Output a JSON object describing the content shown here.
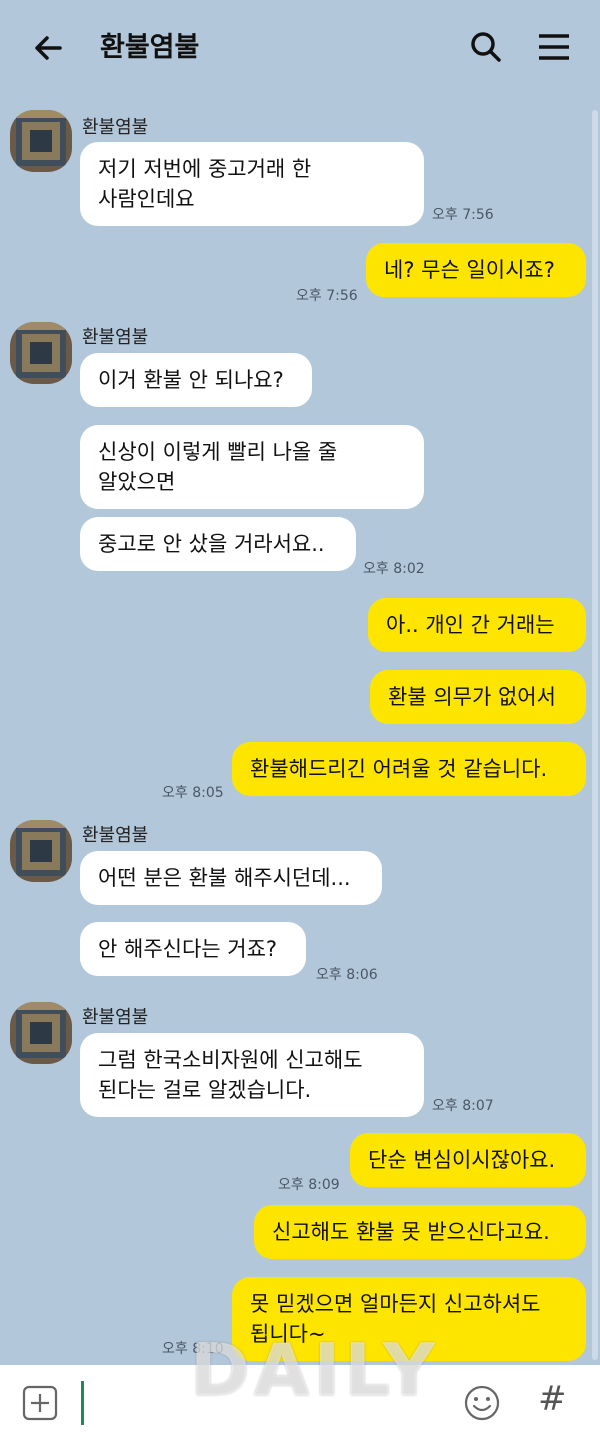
{
  "header": {
    "title": "환불염불",
    "back_icon": "arrow-left-icon",
    "search_icon": "search-icon",
    "menu_icon": "hamburger-menu-icon"
  },
  "colors": {
    "background": "#b2c7da",
    "incoming_bubble": "#ffffff",
    "outgoing_bubble": "#fee500"
  },
  "messages": [
    {
      "sender": "환불염불",
      "text_lines": [
        "저기 저번에 중고거래 한",
        "사람인데요"
      ],
      "time": "오후 7:56"
    },
    {
      "direction": "out",
      "text": "네? 무슨 일이시죠?",
      "time": "오후 7:56"
    },
    {
      "sender": "환불염불",
      "text": "이거 환불 안 되나요?"
    },
    {
      "direction": "in",
      "text_lines": [
        "신상이 이렇게 빨리 나올 줄",
        "알았으면"
      ]
    },
    {
      "direction": "in",
      "text": "중고로 안 샀을 거라서요..",
      "time": "오후 8:02"
    },
    {
      "direction": "out",
      "text": "아.. 개인 간 거래는"
    },
    {
      "direction": "out",
      "text": "환불 의무가 없어서"
    },
    {
      "direction": "out",
      "text": "환불해드리긴 어려울 것 같습니다.",
      "time": "오후 8:05"
    },
    {
      "sender": "환불염불",
      "text": "어떤 분은 환불 해주시던데..."
    },
    {
      "direction": "in",
      "text": "안 해주신다는 거죠?",
      "time": "오후 8:06"
    },
    {
      "sender": "환불염불",
      "text_lines": [
        "그럼 한국소비자원에 신고해도",
        "된다는 걸로 알겠습니다."
      ],
      "time": "오후 8:07"
    },
    {
      "direction": "out",
      "text": "단순 변심이시잖아요.",
      "time": "오후 8:09"
    },
    {
      "direction": "out",
      "text": "신고해도 환불 못 받으신다고요."
    },
    {
      "direction": "out",
      "text_lines": [
        "못 믿겠으면 얼마든지 신고하셔도",
        "됩니다~"
      ],
      "time": "오후 8:10"
    }
  ],
  "input_bar": {
    "plus_icon": "plus-square-icon",
    "emoji_icon": "smiley-icon",
    "hash_label": "#"
  },
  "watermark": "DAILY"
}
